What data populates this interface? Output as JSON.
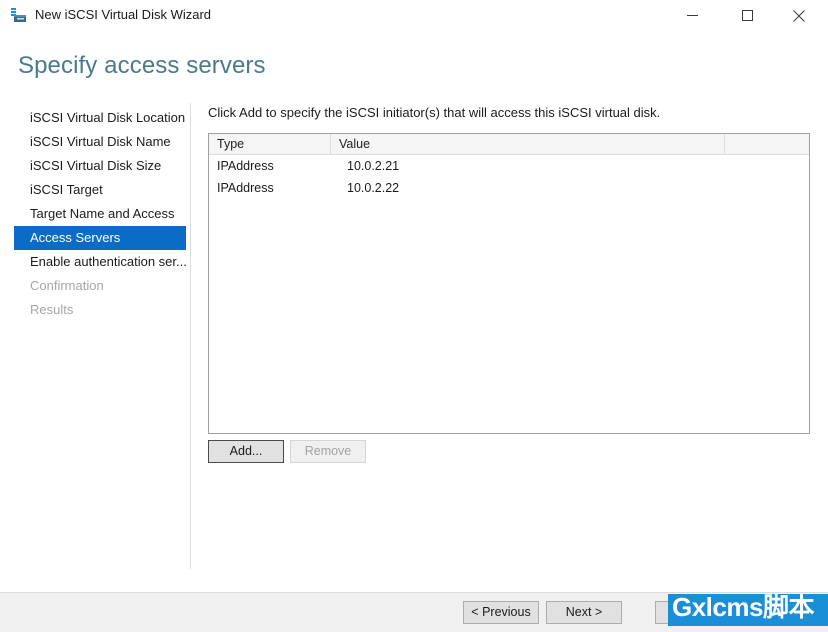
{
  "window": {
    "title": "New iSCSI Virtual Disk Wizard",
    "icon": "iscsi-disk-icon",
    "controls": {
      "minimize": "minimize-icon",
      "maximize": "maximize-icon",
      "close": "close-icon"
    }
  },
  "heading": "Specify access servers",
  "heading_color": "#4a7a8c",
  "accent_color": "#0a6cc4",
  "navigation": {
    "items": [
      {
        "label": "iSCSI Virtual Disk Location",
        "state": "normal"
      },
      {
        "label": "iSCSI Virtual Disk Name",
        "state": "normal"
      },
      {
        "label": "iSCSI Virtual Disk Size",
        "state": "normal"
      },
      {
        "label": "iSCSI Target",
        "state": "normal"
      },
      {
        "label": "Target Name and Access",
        "state": "normal"
      },
      {
        "label": "Access Servers",
        "state": "selected"
      },
      {
        "label": "Enable authentication ser...",
        "state": "normal"
      },
      {
        "label": "Confirmation",
        "state": "disabled"
      },
      {
        "label": "Results",
        "state": "disabled"
      }
    ]
  },
  "main": {
    "instruction": "Click Add to specify the iSCSI initiator(s) that will access this iSCSI virtual disk.",
    "table": {
      "columns": [
        "Type",
        "Value",
        ""
      ],
      "rows": [
        {
          "type": "IPAddress",
          "value": "10.0.2.21"
        },
        {
          "type": "IPAddress",
          "value": "10.0.2.22"
        }
      ]
    },
    "buttons": {
      "add": "Add...",
      "remove": "Remove"
    }
  },
  "footer": {
    "previous": "< Previous",
    "next": "Next >",
    "finish": "",
    "cancel": ""
  },
  "watermark": {
    "text": "Gxlcms脚本",
    "background": "#1a8fd8"
  }
}
